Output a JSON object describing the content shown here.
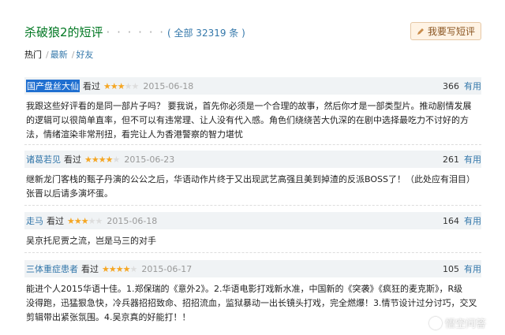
{
  "header": {
    "title": "杀破狼2的短评",
    "dots": "· · · · · ·",
    "all_count": "( 全部 32319 条 )",
    "write_button": "我要写短评"
  },
  "tabs": [
    {
      "label": "热门",
      "active": true
    },
    {
      "label": "最新",
      "active": false
    },
    {
      "label": "好友",
      "active": false
    }
  ],
  "reviews": [
    {
      "author": "国产盘丝大仙",
      "seen": "看过",
      "rating": 3,
      "date": "2015-06-18",
      "useful_count": "366",
      "useful_label": "有用",
      "lines": [
        "我跟这些好评看的是同一部片子吗？ 要我说，首先你必须是一个合理的故事，然后你才是一部类型片。推动剧情发展",
        "的逻辑可以很简单直率，但不可以有违常理、让人没有代入感。角色们绕绕苦大仇深的在剧中选择最吃力不讨好的方",
        "法，情绪渲染非常刑扭，看完让人为香港警察的智力堪忧"
      ]
    },
    {
      "author": "诸葛若见",
      "seen": "看过",
      "rating": 4,
      "date": "2015-06-23",
      "useful_count": "261",
      "useful_label": "有用",
      "lines": [
        "继新龙门客栈的甄子丹演的公公之后，华语动作片终于又出现武艺高强且美到掉渣的反派BOSS了！（此处应有泪目）",
        "张晋以后请多演坏蛋。"
      ]
    },
    {
      "author": "走马",
      "seen": "看过",
      "rating": 3,
      "date": "2015-06-18",
      "useful_count": "164",
      "useful_label": "有用",
      "lines": [
        "吴京托尼贾之流，岂是马三的对手"
      ]
    },
    {
      "author": "三体重症患者",
      "seen": "看过",
      "rating": 4,
      "date": "2015-06-17",
      "useful_count": "105",
      "useful_label": "有用",
      "lines": [
        "能进个人2015华语十佳。1.郑保瑞的《意外2》。2.华语电影打戏新水准，中国新的《突袭》《疯狂的麦克斯》，R级",
        "没得跑，迅猛狠急快，冷兵器招招致命、招招流血，监狱暴动一出长镜头打戏，完全燃爆！3.情节设计过分讨巧，交叉",
        "剪辑带出紧张氛围。4.吴京真的好能打！！"
      ]
    }
  ],
  "watermark": "悟空问答",
  "colors": {
    "accent": "#37a",
    "title": "#072",
    "star": "#f5a623",
    "highlight": "#1f6fd0"
  }
}
